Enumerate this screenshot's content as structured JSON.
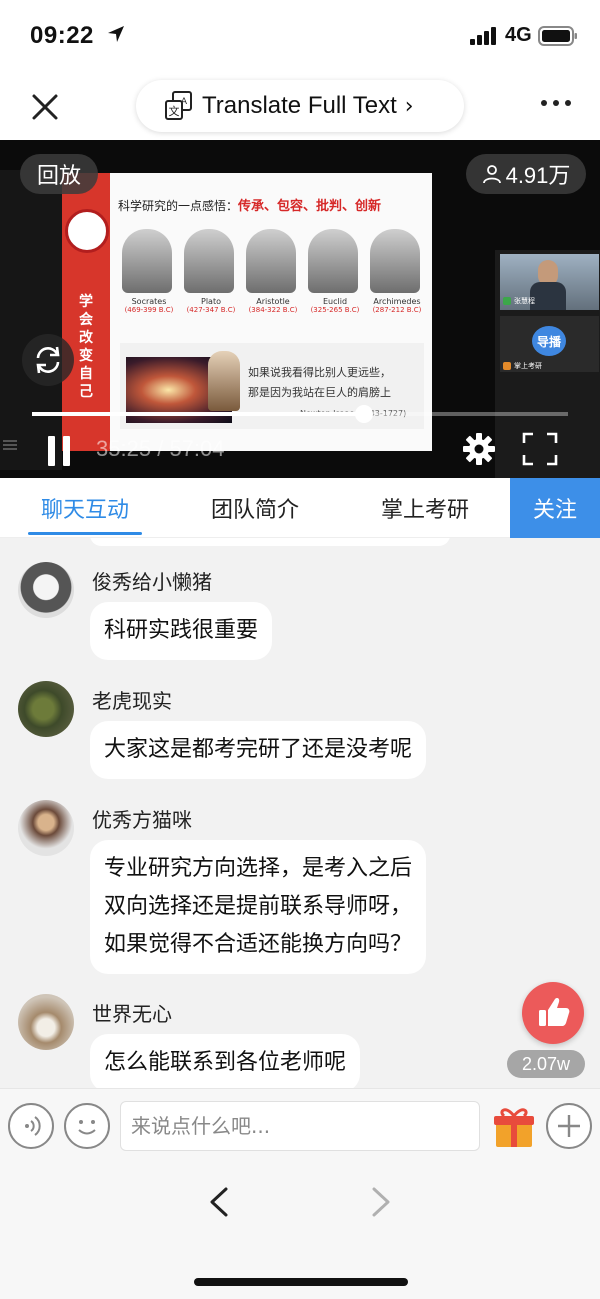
{
  "status": {
    "time": "09:22",
    "network": "4G"
  },
  "nav": {
    "translate_label": "Translate Full Text",
    "chevron": "›"
  },
  "video": {
    "replay_label": "回放",
    "viewers": "4.91万",
    "elapsed": "35:25",
    "separator": "/",
    "duration": "57:04",
    "progress": 0.62,
    "slide": {
      "vertical_text": "学会改变自己",
      "headline_prefix": "科学研究的一点感悟：",
      "headline_keywords": "传承、包容、批判、创新",
      "people": [
        {
          "name": "Socrates",
          "years": "(469-399 B.C)"
        },
        {
          "name": "Plato",
          "years": "(427-347 B.C)"
        },
        {
          "name": "Aristotle",
          "years": "(384-322 B.C)"
        },
        {
          "name": "Euclid",
          "years": "(325-265 B.C)"
        },
        {
          "name": "Archimedes",
          "years": "(287-212 B.C)"
        }
      ],
      "quote_line1": "如果说我看得比别人更远些，",
      "quote_line2": "那是因为我站在巨人的肩膀上",
      "attribution": "Newton Isaac (1643-1727)"
    },
    "cams": [
      {
        "name": "张慧程"
      },
      {
        "name": "掌上考研",
        "badge": "导播"
      }
    ]
  },
  "tabs": [
    {
      "label": "聊天互动",
      "active": true
    },
    {
      "label": "团队简介",
      "active": false
    },
    {
      "label": "掌上考研",
      "active": false
    }
  ],
  "follow_label": "关注",
  "chat": [
    {
      "user": "俊秀给小懒猪",
      "lines": [
        "科研实践很重要"
      ]
    },
    {
      "user": "老虎现实",
      "lines": [
        "大家这是都考完研了还是没考呢"
      ]
    },
    {
      "user": "优秀方猫咪",
      "lines": [
        "专业研究方向选择，是考入之后",
        "双向选择还是提前联系导师呀，",
        "如果觉得不合适还能换方向吗？"
      ]
    },
    {
      "user": "世界无心",
      "lines": [
        "怎么能联系到各位老师呢"
      ]
    }
  ],
  "likes": "2.07w",
  "input": {
    "placeholder": "来说点什么吧..."
  },
  "colors": {
    "accent": "#2f8be6",
    "follow": "#3d8fe8",
    "like": "#ec5a5a",
    "slide_red": "#d7362b"
  }
}
